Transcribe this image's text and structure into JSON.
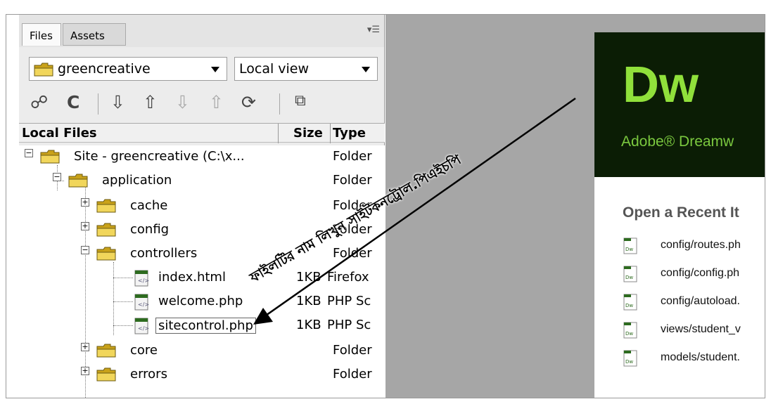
{
  "tabs": {
    "files": "Files",
    "assets": "Assets"
  },
  "panel_menu_icon": "options-menu-icon",
  "site_select": {
    "value": "greencreative"
  },
  "view_select": {
    "value": "Local view"
  },
  "toolbar_icons": [
    "connect-icon",
    "refresh-icon",
    "get-files-icon",
    "put-files-icon",
    "check-out-icon",
    "check-in-icon",
    "synchronize-icon",
    "expand-icon"
  ],
  "columns": {
    "local_files": "Local Files",
    "size": "Size",
    "type": "Type"
  },
  "tree": {
    "site": {
      "name": "Site - greencreative (C:\\x...",
      "type": "Folder"
    },
    "application": {
      "name": "application",
      "type": "Folder"
    },
    "cache": {
      "name": "cache",
      "type": "Folder"
    },
    "config": {
      "name": "config",
      "type": "Folder"
    },
    "controllers": {
      "name": "controllers",
      "type": "Folder"
    },
    "index": {
      "name": "index.html",
      "size": "1KB",
      "type": "Firefox"
    },
    "welcome": {
      "name": "welcome.php",
      "size": "1KB",
      "type": "PHP Sc"
    },
    "sitecontrol": {
      "name": "sitecontrol.php",
      "size": "1KB",
      "type": "PHP Sc"
    },
    "core": {
      "name": "core",
      "type": "Folder"
    },
    "errors": {
      "name": "errors",
      "type": "Folder"
    }
  },
  "welcome_screen": {
    "logo": "Dw",
    "product": "Adobe® Dreamw",
    "recent_title": "Open a Recent It",
    "recent_items": [
      "config/routes.ph",
      "config/config.ph",
      "config/autoload.",
      "views/student_v",
      "models/student."
    ]
  },
  "annotation": {
    "text": "ফাইলটির নাম লিখুন সাইটকনট্রোল.পিএইচপি"
  },
  "colors": {
    "banner_bg": "#0b1d05",
    "logo_green": "#90e03b",
    "panel_bg": "#ececec",
    "workspace_gray": "#a6a6a6"
  }
}
